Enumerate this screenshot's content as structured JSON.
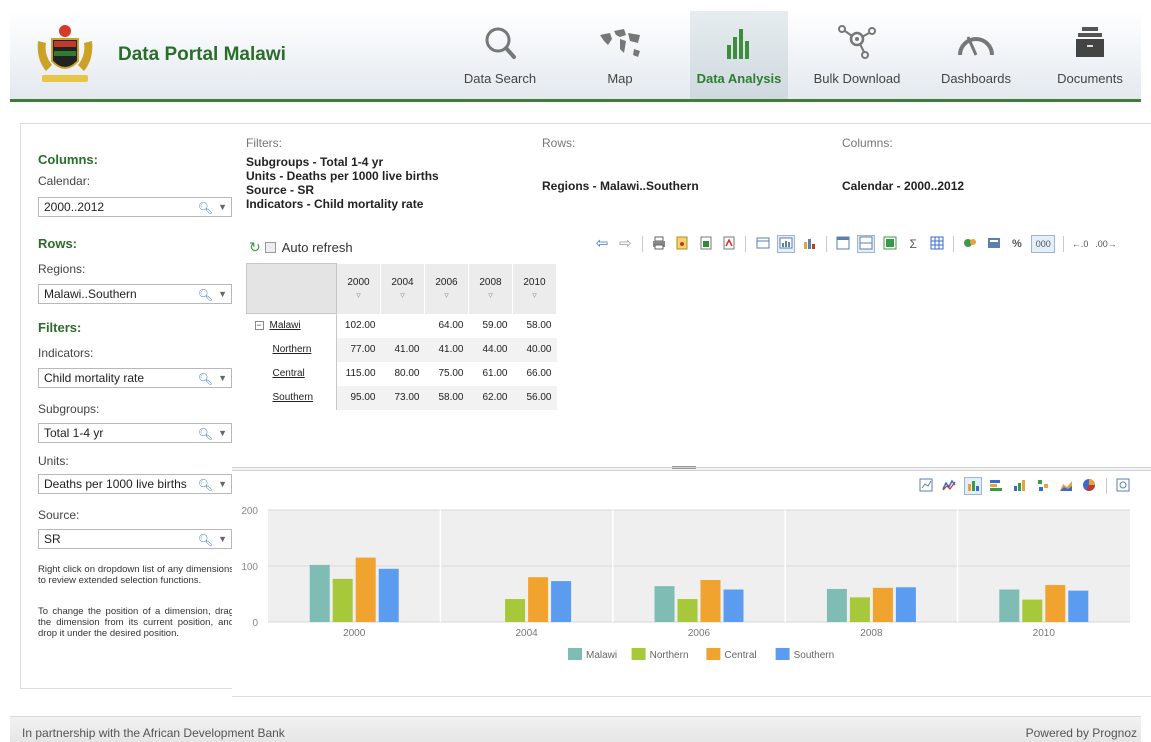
{
  "header": {
    "title": "Data Portal Malawi",
    "nav": [
      {
        "label": "Data Search",
        "icon": "search-icon"
      },
      {
        "label": "Map",
        "icon": "world-map-icon"
      },
      {
        "label": "Data Analysis",
        "icon": "bar-chart-icon",
        "active": true
      },
      {
        "label": "Bulk Download",
        "icon": "nodes-icon"
      },
      {
        "label": "Dashboards",
        "icon": "gauge-icon"
      },
      {
        "label": "Documents",
        "icon": "document-tray-icon"
      }
    ],
    "accent": "#3f7d3a"
  },
  "left": {
    "columns_title": "Columns:",
    "calendar_label": "Calendar:",
    "calendar_value": "2000..2012",
    "rows_title": "Rows:",
    "regions_label": "Regions:",
    "regions_value": "Malawi..Southern",
    "filters_title": "Filters:",
    "indicators_label": "Indicators:",
    "indicators_value": "Child mortality rate",
    "subgroups_label": "Subgroups:",
    "subgroups_value": "Total 1-4 yr",
    "units_label": "Units:",
    "units_value": "Deaths per 1000 live births",
    "source_label": "Source:",
    "source_value": "SR",
    "hint1": "Right click on dropdown list of any dimensions to review extended selection functions.",
    "hint2": "To change the position of a dimension, drag the dimension from its current position, and drop it under the desired position."
  },
  "summary": {
    "filters_label": "Filters:",
    "filters_lines": [
      "Subgroups - Total 1-4 yr",
      "Units - Deaths per 1000 live births",
      "Source - SR",
      "Indicators - Child mortality rate"
    ],
    "rows_label": "Rows:",
    "rows_value": "Regions - Malawi..Southern",
    "columns_label": "Columns:",
    "columns_value": "Calendar - 2000..2012"
  },
  "toolbar": {
    "auto_refresh": "Auto refresh",
    "percent": "%",
    "thousands": "000",
    "sigma": "Σ"
  },
  "table": {
    "years": [
      "2000",
      "2004",
      "2006",
      "2008",
      "2010"
    ],
    "rows": [
      {
        "region": "Malawi",
        "values": [
          "102.00",
          "",
          "64.00",
          "59.00",
          "58.00"
        ],
        "level": 0
      },
      {
        "region": "Northern",
        "values": [
          "77.00",
          "41.00",
          "41.00",
          "44.00",
          "40.00"
        ],
        "level": 1
      },
      {
        "region": "Central",
        "values": [
          "115.00",
          "80.00",
          "75.00",
          "61.00",
          "66.00"
        ],
        "level": 1
      },
      {
        "region": "Southern",
        "values": [
          "95.00",
          "73.00",
          "58.00",
          "62.00",
          "56.00"
        ],
        "level": 1
      }
    ]
  },
  "chart_data": {
    "type": "bar",
    "categories": [
      "2000",
      "2004",
      "2006",
      "2008",
      "2010"
    ],
    "series": [
      {
        "name": "Malawi",
        "color": "#7fbcb4",
        "values": [
          102,
          null,
          64,
          59,
          58
        ]
      },
      {
        "name": "Northern",
        "color": "#a6c83a",
        "values": [
          77,
          41,
          41,
          44,
          40
        ]
      },
      {
        "name": "Central",
        "color": "#f0a32e",
        "values": [
          115,
          80,
          75,
          61,
          66
        ]
      },
      {
        "name": "Southern",
        "color": "#5c9cf0",
        "values": [
          95,
          73,
          58,
          62,
          56
        ]
      }
    ],
    "y_ticks": [
      "0",
      "100",
      "200"
    ],
    "ylim": [
      0,
      200
    ],
    "legend_position": "bottom-center",
    "grid": true
  },
  "footer": {
    "left": "In partnership with the African Development Bank",
    "right": "Powered by Prognoz"
  }
}
